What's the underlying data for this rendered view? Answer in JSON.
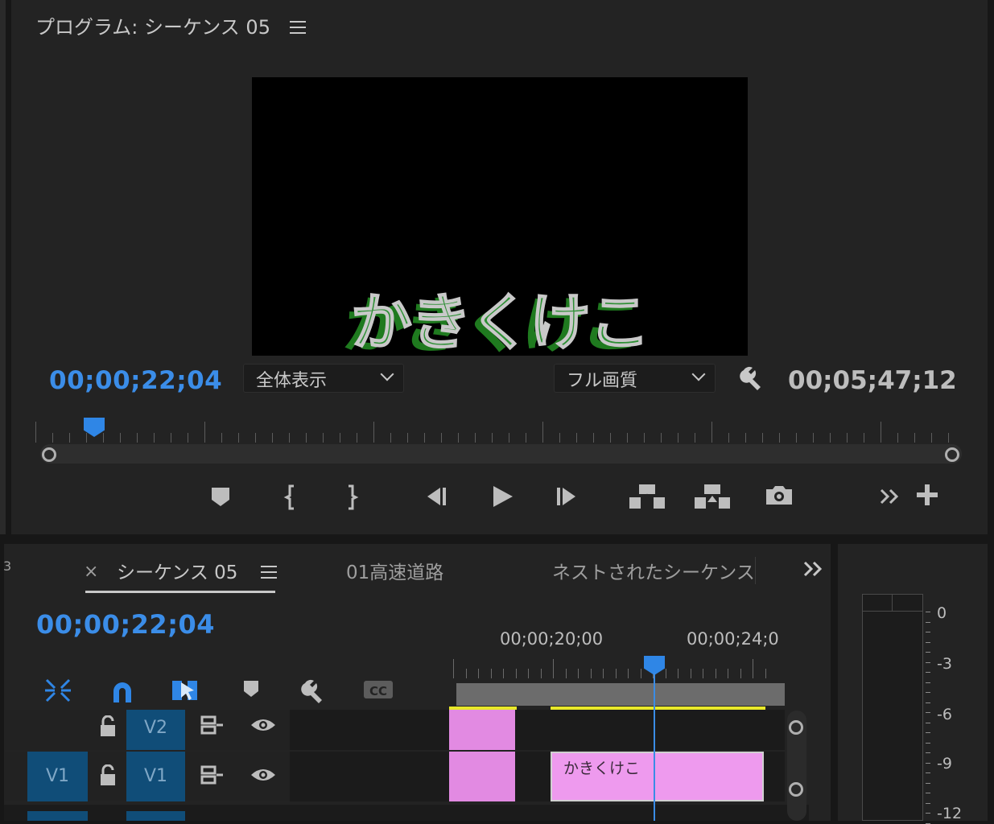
{
  "program_monitor": {
    "title": "プログラム: シーケンス 05",
    "caption": "かきくけこ",
    "current_timecode": "00;00;22;04",
    "zoom_option": "全体表示",
    "quality_option": "フル画質",
    "duration_timecode": "00;05;47;12",
    "controls": [
      "add-marker",
      "mark-in",
      "mark-out",
      "step-back",
      "play",
      "step-forward",
      "lift",
      "extract",
      "export-frame"
    ]
  },
  "timeline": {
    "tabs": [
      {
        "label": "3"
      },
      {
        "label": "シーケンス 05",
        "active": true
      },
      {
        "label": "01高速道路"
      },
      {
        "label": "ネストされたシーケンス"
      }
    ],
    "current_timecode": "00;00;22;04",
    "ruler_labels": [
      "00;00;20;00",
      "00;00;24;0"
    ],
    "tracks": [
      {
        "source": "",
        "target": "V2"
      },
      {
        "source": "V1",
        "target": "V1"
      }
    ],
    "clip_label": "かきくけこ"
  },
  "audio_meter": {
    "db_labels": [
      "0",
      "-3",
      "-6",
      "-9",
      "-12"
    ]
  },
  "colors": {
    "accent_blue": "#2f86e6",
    "clip_pink": "#e28ae2",
    "in_out_yellow": "#e8e82a",
    "track_target": "#104d78"
  }
}
